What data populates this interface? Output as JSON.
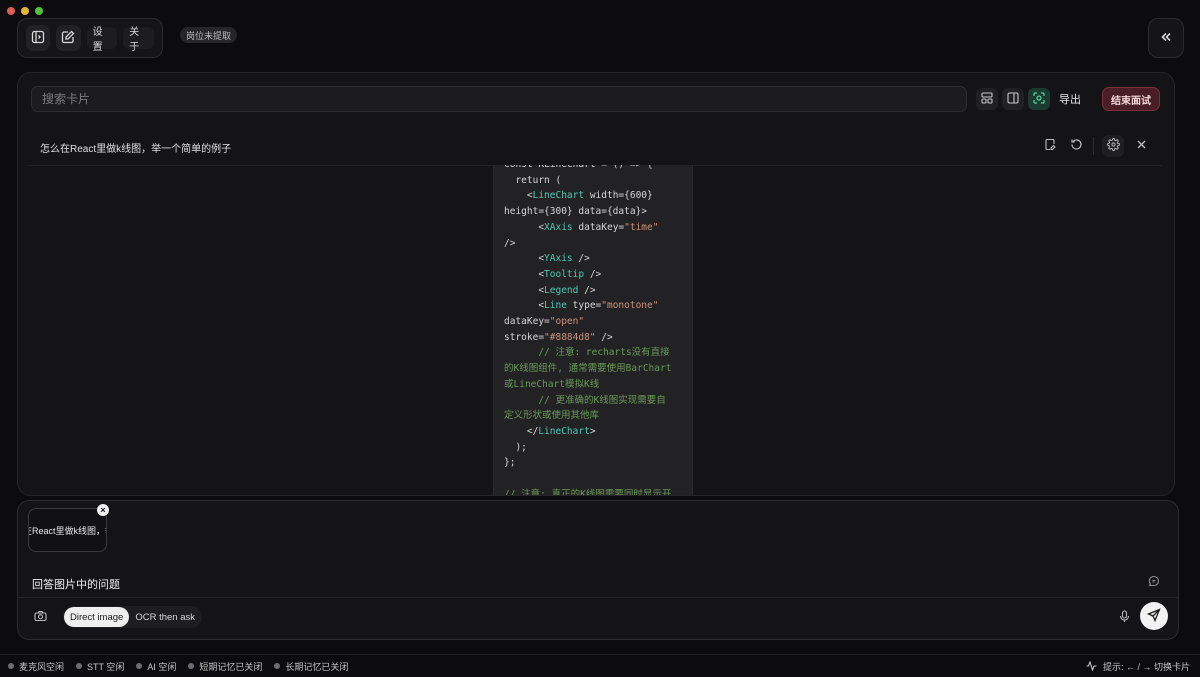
{
  "window": {
    "controls": [
      "close",
      "minimize",
      "zoom"
    ]
  },
  "toolbar": {
    "settings_label": "设置",
    "about_label": "关于",
    "status_badge": "岗位未提取"
  },
  "search": {
    "placeholder": "搜索卡片"
  },
  "actions": {
    "export_label": "导出",
    "end_label": "结束面试"
  },
  "card": {
    "title": "怎么在React里做k线图，举一个简单的例子",
    "code_lines": [
      [
        {
          "t": "const KLineChart = () => {",
          "c": ""
        }
      ],
      [
        {
          "t": "  return (",
          "c": ""
        }
      ],
      [
        {
          "t": "    <",
          "c": ""
        },
        {
          "t": "LineChart",
          "c": "tag"
        },
        {
          "t": " width={600}",
          "c": ""
        }
      ],
      [
        {
          "t": "height={300} data={data}>",
          "c": ""
        }
      ],
      [
        {
          "t": "      <",
          "c": ""
        },
        {
          "t": "XAxis",
          "c": "tag"
        },
        {
          "t": " dataKey=",
          "c": ""
        },
        {
          "t": "\"time\"",
          "c": "str"
        }
      ],
      [
        {
          "t": "/>",
          "c": ""
        }
      ],
      [
        {
          "t": "      <",
          "c": ""
        },
        {
          "t": "YAxis",
          "c": "tag"
        },
        {
          "t": " />",
          "c": ""
        }
      ],
      [
        {
          "t": "      <",
          "c": ""
        },
        {
          "t": "Tooltip",
          "c": "tag"
        },
        {
          "t": " />",
          "c": ""
        }
      ],
      [
        {
          "t": "      <",
          "c": ""
        },
        {
          "t": "Legend",
          "c": "tag"
        },
        {
          "t": " />",
          "c": ""
        }
      ],
      [
        {
          "t": "      <",
          "c": ""
        },
        {
          "t": "Line",
          "c": "tag"
        },
        {
          "t": " type=",
          "c": ""
        },
        {
          "t": "\"monotone\"",
          "c": "str"
        }
      ],
      [
        {
          "t": "dataKey=",
          "c": ""
        },
        {
          "t": "\"open\"",
          "c": "str"
        }
      ],
      [
        {
          "t": "stroke=",
          "c": ""
        },
        {
          "t": "\"#8884d8\"",
          "c": "str"
        },
        {
          "t": " />",
          "c": ""
        }
      ],
      [
        {
          "t": "      // 注意: recharts没有直接",
          "c": "com"
        }
      ],
      [
        {
          "t": "的K线图组件, 通常需要使用BarChart",
          "c": "com"
        }
      ],
      [
        {
          "t": "或LineChart模拟K线",
          "c": "com"
        }
      ],
      [
        {
          "t": "      // 更准确的K线图实现需要自",
          "c": "com"
        }
      ],
      [
        {
          "t": "定义形状或使用其他库",
          "c": "com"
        }
      ],
      [
        {
          "t": "    </",
          "c": ""
        },
        {
          "t": "LineChart",
          "c": "tag"
        },
        {
          "t": ">",
          "c": ""
        }
      ],
      [
        {
          "t": "  );",
          "c": ""
        }
      ],
      [
        {
          "t": "};",
          "c": ""
        }
      ],
      [
        {
          "t": "",
          "c": ""
        }
      ],
      [
        {
          "t": "// 注意: 真正的K线图需要同时显示开",
          "c": "com"
        }
      ]
    ]
  },
  "input": {
    "attachment_text": "怎么在React里做k线图，举一个简单的例子",
    "question": "回答图片中的问题",
    "modes": [
      "Direct image",
      "OCR then ask"
    ],
    "active_mode": "Direct image"
  },
  "status_bar": {
    "items": [
      "麦克风空闲",
      "STT 空闲",
      "AI 空闲",
      "短期记忆已关闭",
      "长期记忆已关闭"
    ],
    "hint": "提示: ← / → 切换卡片"
  }
}
